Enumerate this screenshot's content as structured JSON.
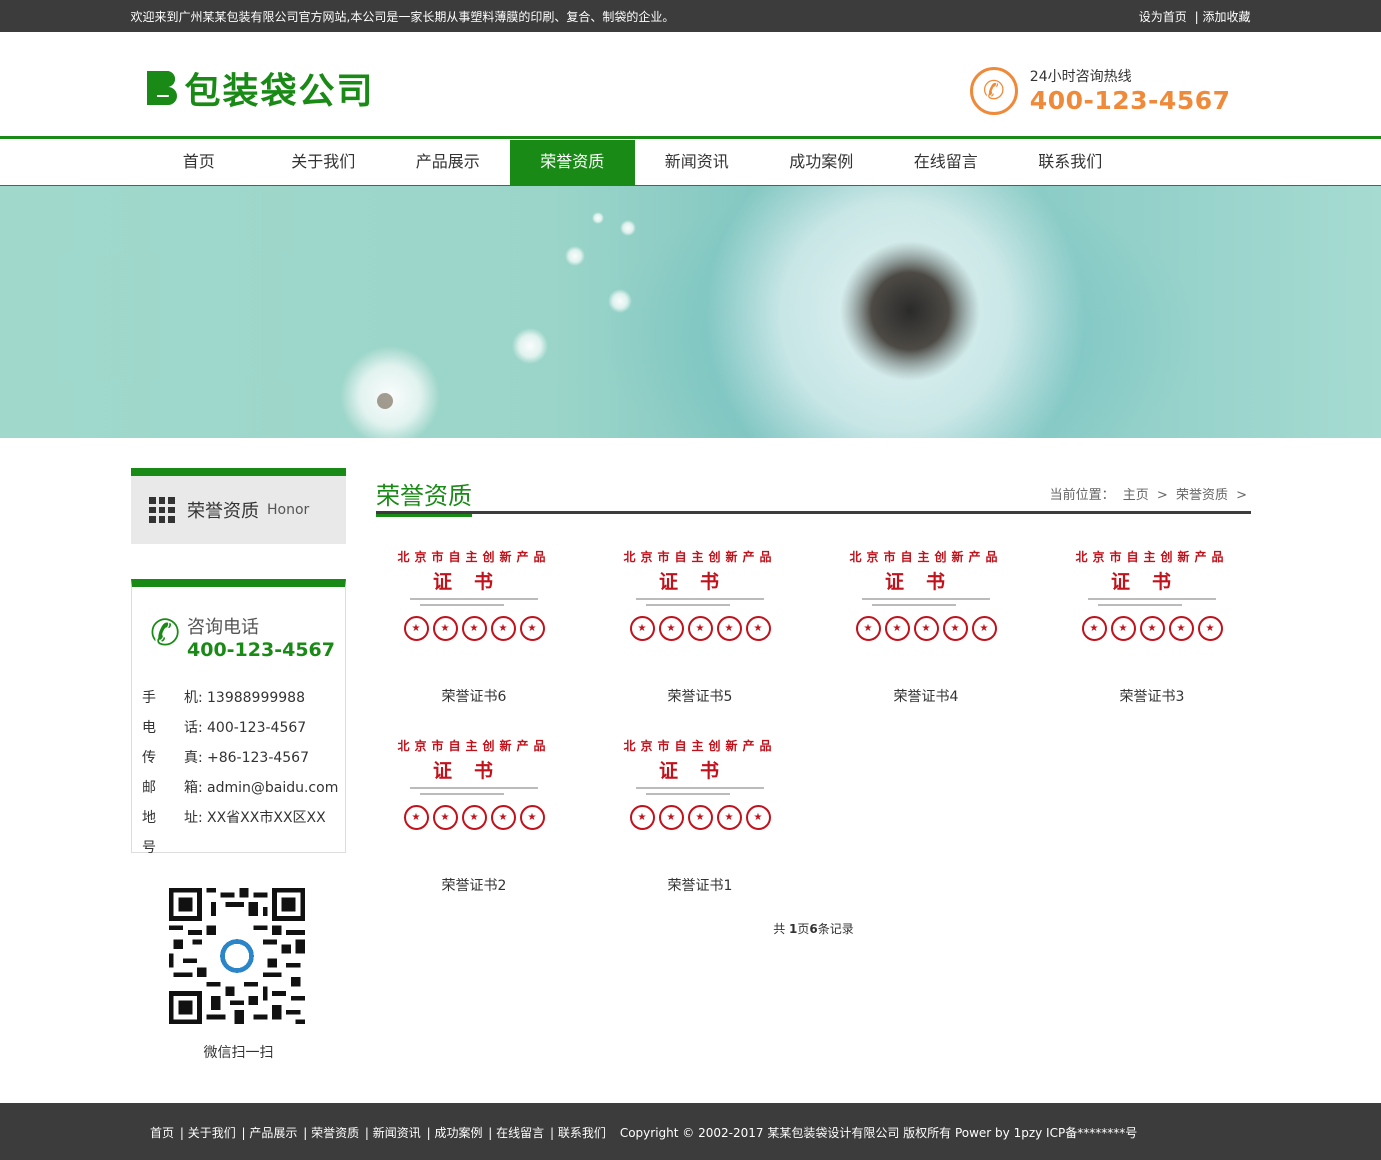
{
  "topbar": {
    "welcome": "欢迎来到广州某某包装有限公司官方网站,本公司是一家长期从事塑料薄膜的印刷、复合、制袋的企业。",
    "set_home": "设为首页",
    "sep": "|",
    "add_fav": "添加收藏"
  },
  "header": {
    "logo_text": "包装袋公司",
    "hotline_label": "24小时咨询热线",
    "hotline_number": "400-123-4567"
  },
  "nav": {
    "items": [
      "首页",
      "关于我们",
      "产品展示",
      "荣誉资质",
      "新闻资讯",
      "成功案例",
      "在线留言",
      "联系我们"
    ],
    "active_index": 3
  },
  "sidebar": {
    "category_title": "荣誉资质",
    "category_en": "Honor",
    "contact_title": "咨询电话",
    "contact_number": "400-123-4567",
    "contact_lines": [
      {
        "key": "手　　机:",
        "value": "13988999988"
      },
      {
        "key": "电　　话:",
        "value": "400-123-4567"
      },
      {
        "key": "传　　真:",
        "value": "+86-123-4567"
      },
      {
        "key": "邮　　箱:",
        "value": "admin@baidu.com"
      },
      {
        "key": "地　　址:",
        "value": "XX省XX市XX区XX"
      },
      {
        "key": "号",
        "value": ""
      }
    ],
    "qr_caption": "微信扫一扫"
  },
  "main": {
    "title": "荣誉资质",
    "breadcrumb_label": "当前位置：",
    "breadcrumb_home": "主页",
    "breadcrumb_current": "荣誉资质",
    "crumb_sep": ">",
    "cert_line1": "北京市自主创新产品",
    "cert_line2": "证书",
    "certs": [
      "荣誉证书6",
      "荣誉证书5",
      "荣誉证书4",
      "荣誉证书3",
      "荣誉证书2",
      "荣誉证书1"
    ],
    "pager_prefix": "共",
    "pager_pages": "1",
    "pager_mid": "页",
    "pager_count": "6",
    "pager_suffix": "条记录"
  },
  "footer": {
    "links": [
      "首页",
      "关于我们",
      "产品展示",
      "荣誉资质",
      "新闻资讯",
      "成功案例",
      "在线留言",
      "联系我们"
    ],
    "copyright": "Copyright © 2002-2017 某某包装袋设计有限公司 版权所有 Power by 1pzy ICP备********号"
  },
  "colors": {
    "brand_green": "#1a8a16",
    "accent_orange": "#ef8a3a",
    "dark_bar": "#3c3c3c",
    "stamp_red": "#c1121c"
  }
}
